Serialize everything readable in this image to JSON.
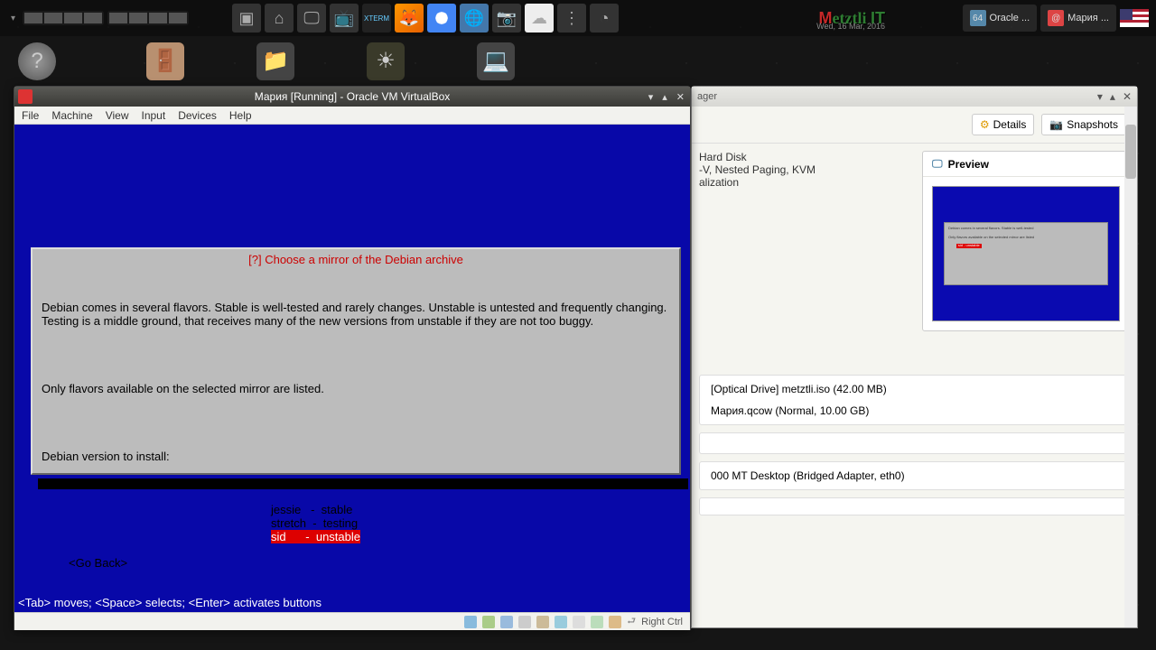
{
  "taskbar": {
    "brand": "Metztli IT",
    "date": "Wed, 16 Mar, 2016",
    "apps": [
      {
        "label": "Oracle ..."
      },
      {
        "label": "Мария ..."
      }
    ]
  },
  "manager": {
    "title_suffix": "ager",
    "tabs": {
      "details": "Details",
      "snapshots": "Snapshots"
    },
    "vminfo1": "Hard Disk",
    "vminfo2": "-V, Nested Paging, KVM",
    "vminfo3": "alization",
    "preview_title": "Preview",
    "storage": {
      "optical": "[Optical Drive] metztli.iso (42.00 MB)",
      "disk": "Мария.qcow (Normal, 10.00 GB)"
    },
    "network": "000 MT Desktop (Bridged Adapter, eth0)"
  },
  "vm": {
    "title": "Мария [Running] - Oracle VM VirtualBox",
    "menu": [
      "File",
      "Machine",
      "View",
      "Input",
      "Devices",
      "Help"
    ],
    "dialog_title": "[?] Choose a mirror of the Debian archive",
    "para1": "Debian comes in several flavors. Stable is well-tested and rarely changes. Unstable is untested and frequently changing. Testing is a middle ground, that receives many of the new versions from unstable if they are not too buggy.",
    "para2": "Only flavors available on the selected mirror are listed.",
    "prompt": "Debian version to install:",
    "options": [
      {
        "text": "jessie   -  stable",
        "selected": false
      },
      {
        "text": "stretch  -  testing",
        "selected": false
      },
      {
        "text": "sid      -  unstable",
        "selected": true
      }
    ],
    "goback": "<Go Back>",
    "hint": "<Tab> moves; <Space> selects; <Enter> activates buttons",
    "hostkey": "Right Ctrl"
  }
}
